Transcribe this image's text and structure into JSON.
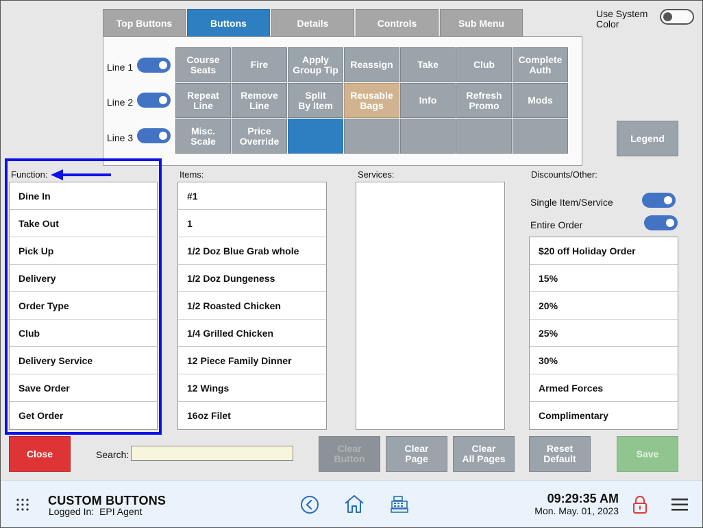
{
  "tabs": [
    {
      "label": "Top Buttons",
      "active": false
    },
    {
      "label": "Buttons",
      "active": true
    },
    {
      "label": "Details",
      "active": false
    },
    {
      "label": "Controls",
      "active": false
    },
    {
      "label": "Sub Menu",
      "active": false
    }
  ],
  "system_color": {
    "label": "Use System Color",
    "enabled": false
  },
  "lines": [
    {
      "label": "Line 1",
      "enabled": true
    },
    {
      "label": "Line 2",
      "enabled": true
    },
    {
      "label": "Line 3",
      "enabled": true
    }
  ],
  "grid": [
    [
      {
        "label": "Course\nSeats",
        "style": "gray"
      },
      {
        "label": "Fire",
        "style": "gray"
      },
      {
        "label": "Apply\nGroup Tip",
        "style": "gray"
      },
      {
        "label": "Reassign",
        "style": "gray"
      },
      {
        "label": "Take",
        "style": "gray"
      },
      {
        "label": "Club",
        "style": "gray"
      },
      {
        "label": "Complete\nAuth",
        "style": "gray"
      }
    ],
    [
      {
        "label": "Repeat\nLine",
        "style": "gray"
      },
      {
        "label": "Remove\nLine",
        "style": "gray"
      },
      {
        "label": "Split\nBy Item",
        "style": "gray"
      },
      {
        "label": "Reusable\nBags",
        "style": "tan"
      },
      {
        "label": "Info",
        "style": "gray"
      },
      {
        "label": "Refresh\nPromo",
        "style": "gray"
      },
      {
        "label": "Mods",
        "style": "gray"
      }
    ],
    [
      {
        "label": "Misc.\nScale",
        "style": "gray"
      },
      {
        "label": "Price\nOverride",
        "style": "gray"
      },
      {
        "label": "",
        "style": "blue"
      },
      {
        "label": "",
        "style": "gray"
      },
      {
        "label": "",
        "style": "gray"
      },
      {
        "label": "",
        "style": "gray"
      },
      {
        "label": "",
        "style": "gray"
      }
    ]
  ],
  "legend_label": "Legend",
  "function": {
    "label": "Function:",
    "items": [
      "Dine In",
      "Take Out",
      "Pick Up",
      "Delivery",
      "Order Type",
      "Club",
      "Delivery Service",
      "Save Order",
      "Get Order"
    ]
  },
  "items": {
    "label": "Items:",
    "items": [
      "#1",
      "1",
      "1/2 Doz Blue Grab whole",
      "1/2 Doz Dungeness",
      "1/2 Roasted Chicken",
      "1/4 Grilled Chicken",
      "12 Piece Family Dinner",
      "12 Wings",
      "16oz Filet"
    ]
  },
  "services": {
    "label": "Services:",
    "items": []
  },
  "discounts": {
    "label": "Discounts/Other:",
    "single_item_label": "Single Item/Service",
    "single_item_enabled": true,
    "entire_order_label": "Entire Order",
    "entire_order_enabled": true,
    "items": [
      "$20 off Holiday Order",
      "15%",
      "20%",
      "25%",
      "30%",
      "Armed Forces",
      "Complimentary"
    ]
  },
  "actions": {
    "close": "Close",
    "search_label": "Search:",
    "search_value": "",
    "clear_button": "Clear\nButton",
    "clear_page": "Clear\nPage",
    "clear_all_pages": "Clear\nAll Pages",
    "reset_default": "Reset\nDefault",
    "save": "Save"
  },
  "footer": {
    "title": "CUSTOM BUTTONS",
    "logged_in_label": "Logged In:",
    "user": "EPI Agent",
    "time": "09:29:35 AM",
    "date": "Mon. May. 01, 2023"
  },
  "colors": {
    "accent_blue": "#2e7fc1",
    "toggle_blue": "#4374c4",
    "close_red": "#de3436",
    "save_green": "#90c590",
    "highlight": "#0c12e8",
    "reusable_bags_tan": "#d1b48f"
  }
}
